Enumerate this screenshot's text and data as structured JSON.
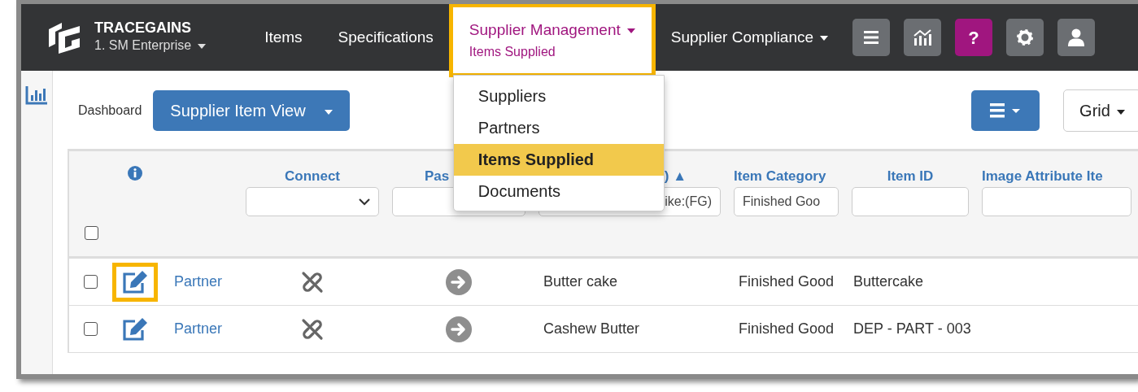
{
  "brand": {
    "name": "TRACEGAINS",
    "account": "1. SM Enterprise"
  },
  "nav": [
    {
      "label": "Items",
      "dropdown": false,
      "selected": false,
      "highlighted": false
    },
    {
      "label": "Specifications",
      "dropdown": false,
      "selected": false,
      "highlighted": false
    },
    {
      "label": "Supplier Management",
      "sublabel": "Items Supplied",
      "dropdown": true,
      "selected": true,
      "highlighted": true
    },
    {
      "label": "Supplier Compliance",
      "dropdown": true,
      "selected": false,
      "highlighted": false
    }
  ],
  "help_label": "?",
  "dropdown_menu": [
    {
      "label": "Suppliers",
      "selected": false
    },
    {
      "label": "Partners",
      "selected": false
    },
    {
      "label": "Items Supplied",
      "selected": true
    },
    {
      "label": "Documents",
      "selected": false
    }
  ],
  "toolbar": {
    "dashboard": "Dashboard",
    "view": "Supplier Item View",
    "mode": "Grid"
  },
  "table": {
    "select_all": {
      "checked": false
    },
    "columns": [
      {
        "label": "Connect",
        "kind": "select"
      },
      {
        "label": "Pas",
        "kind": "text"
      },
      {
        "label": ") ▲",
        "kind": "text",
        "value": "ike:(FG)"
      },
      {
        "label": "Item Category",
        "kind": "text",
        "value": "Finished Goo"
      },
      {
        "label": "Item ID",
        "kind": "text"
      },
      {
        "label": "Image Attribute Ite",
        "kind": "text"
      }
    ],
    "rows": [
      {
        "checked": false,
        "highlighted": true,
        "link": "Partner",
        "connected": false,
        "name": "Butter cake",
        "category": "Finished Good",
        "item_id": "Buttercake"
      },
      {
        "checked": false,
        "highlighted": false,
        "link": "Partner",
        "connected": false,
        "name": "Cashew Butter",
        "category": "Finished Good",
        "item_id": "DEP - PART - 003"
      }
    ]
  }
}
